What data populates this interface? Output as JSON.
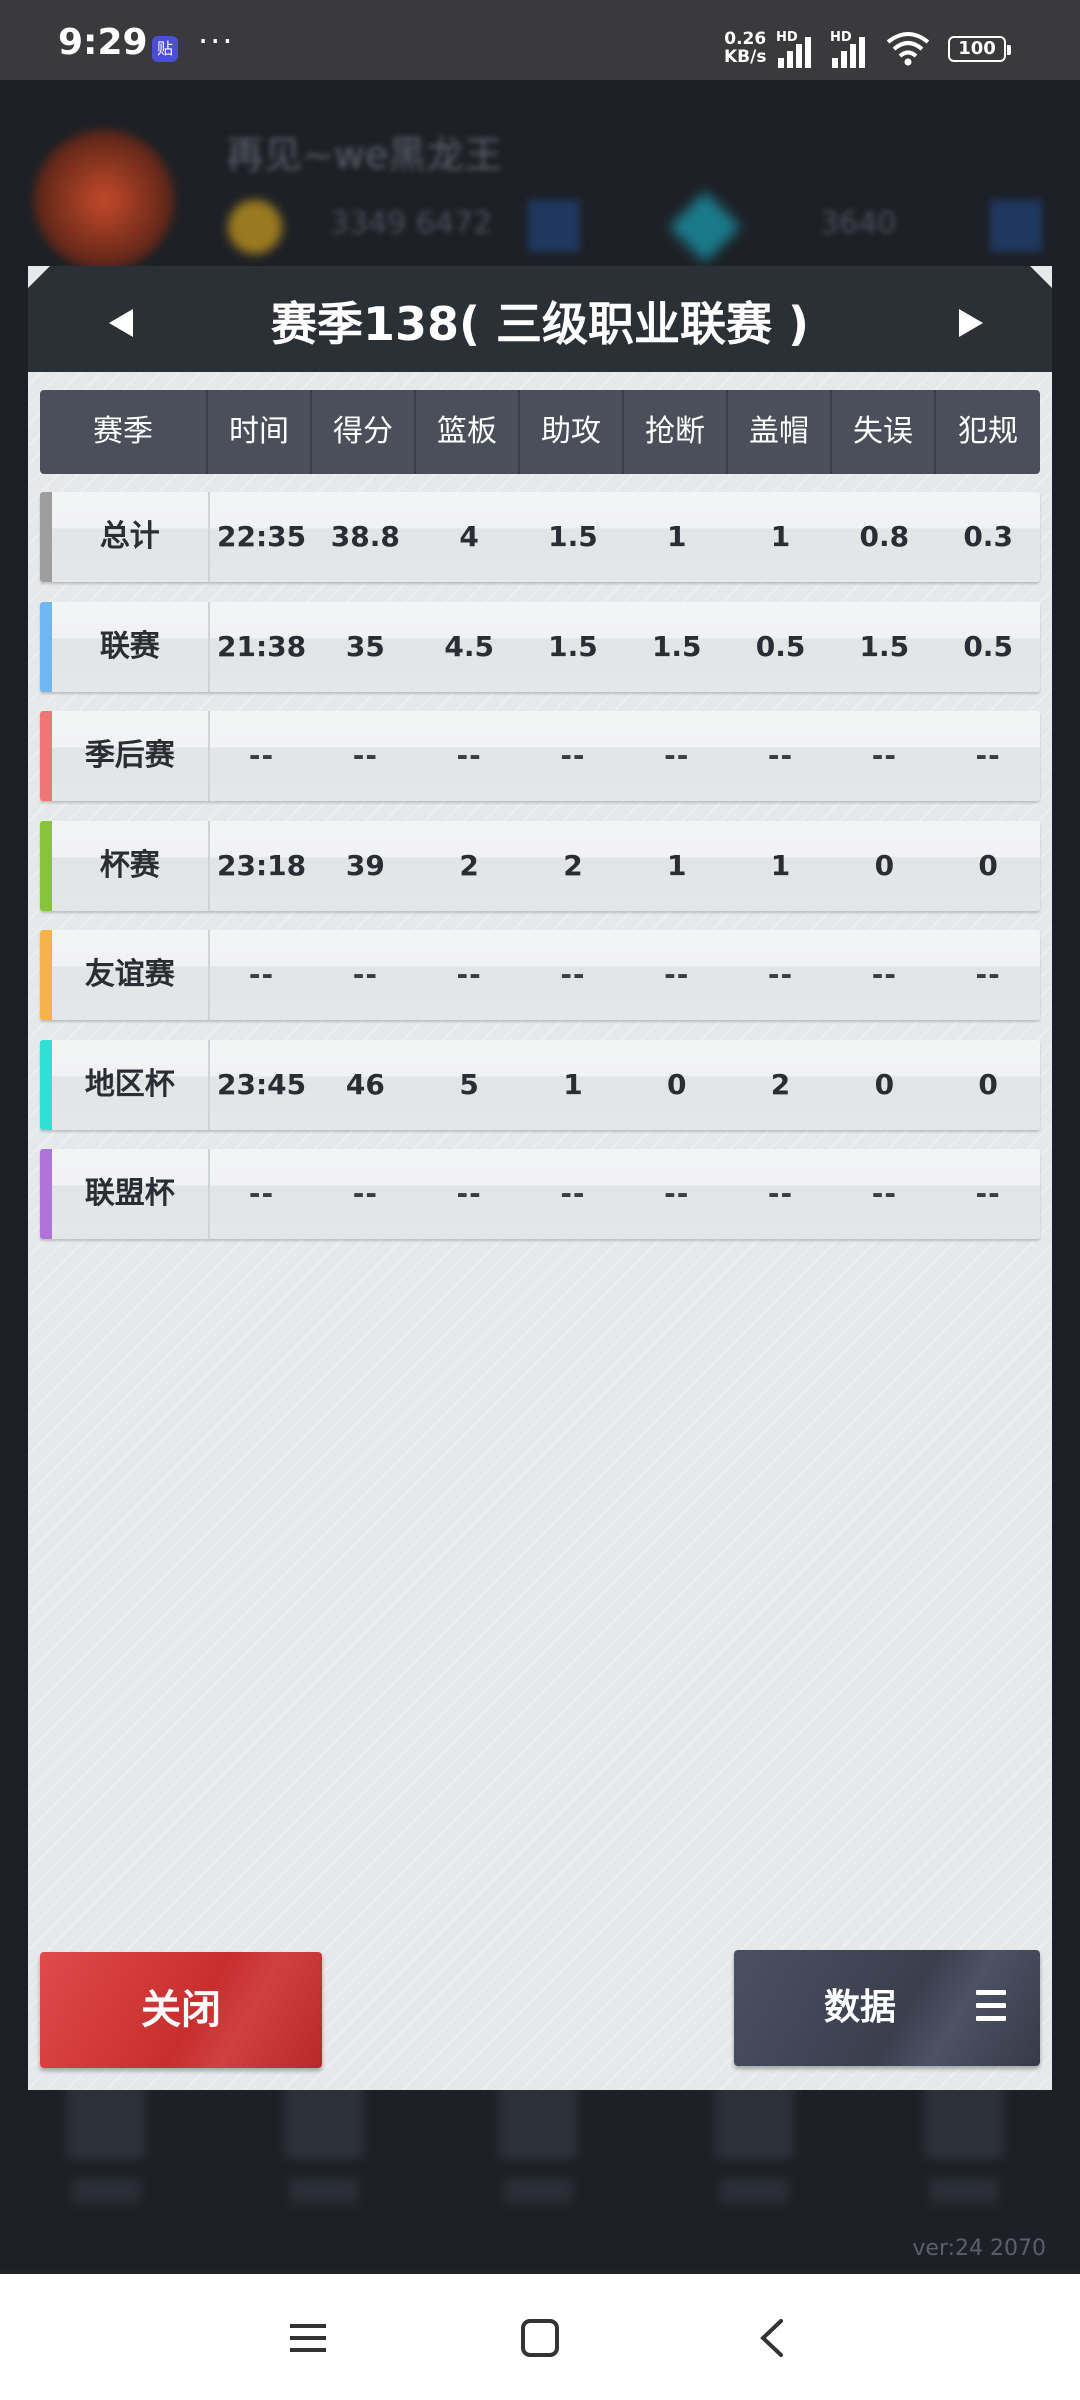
{
  "status_bar": {
    "time": "9:29",
    "app_icon_glyph": "贴",
    "more": "···",
    "net_speed_value": "0.26",
    "net_speed_unit": "KB/s",
    "hd_label": "HD",
    "battery": "100"
  },
  "background": {
    "player_name": "再见~we黑龙王",
    "coins": "3349 6472",
    "diamonds": "3640",
    "version": "ver:24  2070"
  },
  "dialog": {
    "title": "赛季138( 三级职业联赛 )",
    "columns": [
      "赛季",
      "时间",
      "得分",
      "篮板",
      "助攻",
      "抢断",
      "盖帽",
      "失误",
      "犯规"
    ],
    "rows": [
      {
        "label": "总计",
        "accent": "#9e9e9e",
        "values": [
          "22:35",
          "38.8",
          "4",
          "1.5",
          "1",
          "1",
          "0.8",
          "0.3"
        ]
      },
      {
        "label": "联赛",
        "accent": "#6fb6f2",
        "values": [
          "21:38",
          "35",
          "4.5",
          "1.5",
          "1.5",
          "0.5",
          "1.5",
          "0.5"
        ]
      },
      {
        "label": "季后赛",
        "accent": "#f07575",
        "values": [
          "--",
          "--",
          "--",
          "--",
          "--",
          "--",
          "--",
          "--"
        ]
      },
      {
        "label": "杯赛",
        "accent": "#86c53a",
        "values": [
          "23:18",
          "39",
          "2",
          "2",
          "1",
          "1",
          "0",
          "0"
        ]
      },
      {
        "label": "友谊赛",
        "accent": "#f8b24a",
        "values": [
          "--",
          "--",
          "--",
          "--",
          "--",
          "--",
          "--",
          "--"
        ]
      },
      {
        "label": "地区杯",
        "accent": "#2fe0d6",
        "values": [
          "23:45",
          "46",
          "5",
          "1",
          "0",
          "2",
          "0",
          "0"
        ]
      },
      {
        "label": "联盟杯",
        "accent": "#b073d8",
        "values": [
          "--",
          "--",
          "--",
          "--",
          "--",
          "--",
          "--",
          "--"
        ]
      }
    ],
    "close_label": "关闭",
    "data_label": "数据"
  },
  "icons": {
    "prev": "triangle-left-icon",
    "next": "triangle-right-icon",
    "menu": "hamburger-icon",
    "nav_recents": "recents-icon",
    "nav_home": "home-icon",
    "nav_back": "back-icon"
  }
}
